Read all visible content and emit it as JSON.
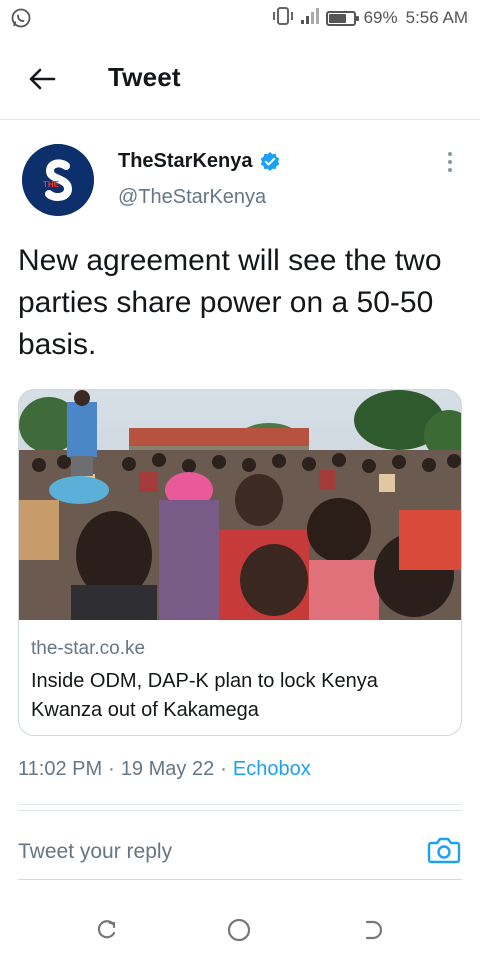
{
  "status_bar": {
    "battery_percent_label": "69%",
    "battery_level": 0.69,
    "time": "5:56 AM",
    "icons": [
      "whatsapp-icon",
      "vibrate-icon",
      "signal-icon",
      "battery-icon"
    ]
  },
  "header": {
    "title": "Tweet",
    "back_icon": "arrow-left-icon"
  },
  "tweet": {
    "author_name": "TheStarKenya",
    "author_handle": "@TheStarKenya",
    "verified": true,
    "avatar_text": "THE",
    "text": "New agreement will see the two parties share power on a 50-50 basis.",
    "card": {
      "domain": "the-star.co.ke",
      "title": "Inside ODM, DAP-K plan to lock Kenya Kwanza out of Kakamega"
    },
    "time": "11:02 PM",
    "date": "19 May 22",
    "separator": "·",
    "source": "Echobox"
  },
  "reply": {
    "placeholder": "Tweet your reply"
  },
  "colors": {
    "accent": "#1da1f2",
    "secondary_text": "#657786",
    "avatar_bg": "#0d2f6b"
  },
  "nav_bar": {
    "icons": [
      "recent-apps-icon",
      "home-icon",
      "back-nav-icon"
    ]
  }
}
